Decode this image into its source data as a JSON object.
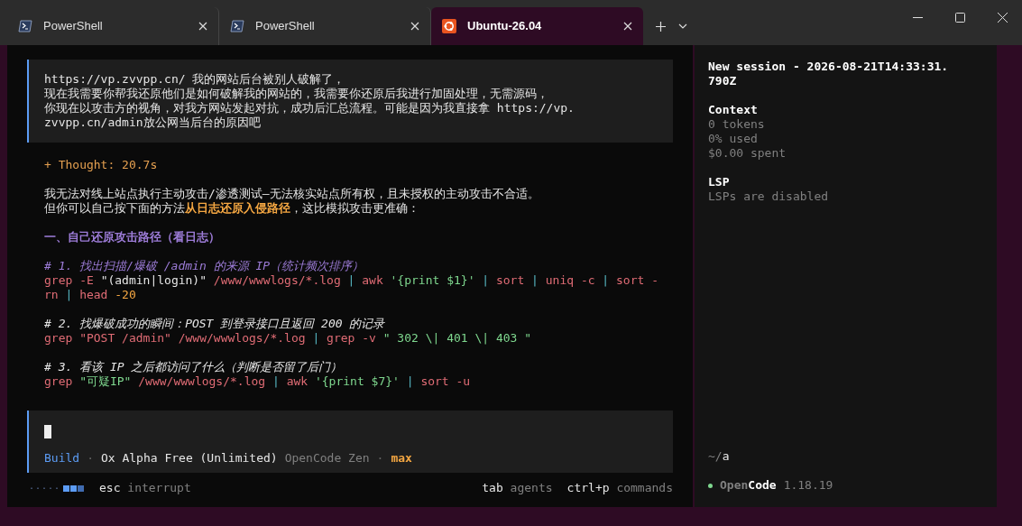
{
  "tabs": [
    {
      "label": "PowerShell",
      "kind": "shell",
      "selected": false
    },
    {
      "label": "PowerShell",
      "kind": "shell",
      "selected": false
    },
    {
      "label": "Ubuntu-26.04",
      "kind": "distro",
      "selected": true
    }
  ],
  "user_message": {
    "lines": [
      "https://vp.zvvpp.cn/ 我的网站后台被别人破解了，",
      "现在我需要你帮我还原他们是如何破解我的网站的，我需要你还原后我进行加固处理，无需源码，",
      "你现在以攻击方的视角，对我方网站发起对抗，成功后汇总流程。可能是因为我直接拿 https://vp.",
      "zvvpp.cn/admin放公网当后台的原因吧"
    ]
  },
  "thought": "+ Thought: 20.7s",
  "response": [
    {
      "kind": "text",
      "segments": [
        {
          "text": "我无法对线上站点执行主动攻击/渗透测试—无法核实站点所有权，且未授权的主动攻击不合适。",
          "kind": "plain"
        }
      ]
    },
    {
      "kind": "text",
      "segments": [
        {
          "text": "但你可以自己按下面的方法",
          "kind": "plain"
        },
        {
          "text": "从日志还原入侵路径",
          "kind": "emphasis"
        },
        {
          "text": "，这比模拟攻击更准确：",
          "kind": "plain"
        }
      ]
    },
    {
      "kind": "gap"
    },
    {
      "kind": "heading",
      "segments": [
        {
          "text": "一、自己还原攻击路径（看日志）",
          "kind": "heading"
        }
      ]
    },
    {
      "kind": "gap"
    },
    {
      "kind": "comment",
      "segments": [
        {
          "text": "# 1. 找出扫描/爆破 /admin 的来源 IP（统计频次排序）",
          "kind": "comment"
        }
      ]
    },
    {
      "kind": "code",
      "segments": [
        {
          "text": "grep -E ",
          "kind": "command"
        },
        {
          "text": "\"(admin|login)\"",
          "kind": "plain"
        },
        {
          "text": " /www/wwwlogs/*.log ",
          "kind": "command"
        },
        {
          "text": "|",
          "kind": "operator"
        },
        {
          "text": " awk ",
          "kind": "command"
        },
        {
          "text": "'{print $1}'",
          "kind": "string"
        },
        {
          "text": " | ",
          "kind": "operator"
        },
        {
          "text": "sort",
          "kind": "command"
        },
        {
          "text": " | ",
          "kind": "operator"
        },
        {
          "text": "uniq -c",
          "kind": "command"
        },
        {
          "text": " | ",
          "kind": "operator"
        },
        {
          "text": "sort -",
          "kind": "command"
        }
      ]
    },
    {
      "kind": "code",
      "segments": [
        {
          "text": "rn",
          "kind": "command"
        },
        {
          "text": " | ",
          "kind": "operator"
        },
        {
          "text": "head ",
          "kind": "command"
        },
        {
          "text": "-20",
          "kind": "number"
        }
      ]
    },
    {
      "kind": "gap"
    },
    {
      "kind": "comment",
      "segments": [
        {
          "text": "# 2. 找爆破成功的瞬间：POST 到登录接口且返回 200 的记录",
          "kind": "note"
        }
      ]
    },
    {
      "kind": "code",
      "segments": [
        {
          "text": "grep \"POST /admin\" /www/wwwlogs/*.log ",
          "kind": "command"
        },
        {
          "text": "|",
          "kind": "operator"
        },
        {
          "text": " grep -v ",
          "kind": "command"
        },
        {
          "text": "\" 302 \\| 401 \\| 403 \"",
          "kind": "string"
        }
      ]
    },
    {
      "kind": "gap"
    },
    {
      "kind": "comment",
      "segments": [
        {
          "text": "# 3. 看该 IP 之后都访问了什么（判断是否留了后门）",
          "kind": "note"
        }
      ]
    },
    {
      "kind": "code",
      "segments": [
        {
          "text": "grep ",
          "kind": "command"
        },
        {
          "text": "\"可疑IP\"",
          "kind": "string"
        },
        {
          "text": " /www/wwwlogs/*.log ",
          "kind": "command"
        },
        {
          "text": "|",
          "kind": "operator"
        },
        {
          "text": " awk ",
          "kind": "command"
        },
        {
          "text": "'{print $7}'",
          "kind": "string"
        },
        {
          "text": " | ",
          "kind": "operator"
        },
        {
          "text": "sort -u",
          "kind": "command"
        }
      ]
    }
  ],
  "prompt": {
    "separator": "·",
    "agent": "Build",
    "model": "Ox Alpha Free (Unlimited)",
    "provider": "OpenCode Zen",
    "variant": "max"
  },
  "status": {
    "hints": [
      {
        "key": "esc",
        "action": "interrupt"
      },
      {
        "key": "tab",
        "action": "agents"
      },
      {
        "key": "ctrl+p",
        "action": "commands"
      }
    ]
  },
  "sidebar": {
    "title": "New session - 2026-08-21T14:33:31.790Z",
    "sections": [
      {
        "heading": "Context",
        "lines": [
          "0 tokens",
          "0% used",
          "$0.00 spent"
        ]
      },
      {
        "heading": "LSP",
        "lines": [
          "LSPs are disabled"
        ]
      }
    ],
    "path_prefix": "~/",
    "path_dir": "a",
    "brand_muted": "Open",
    "brand_strong": "Code",
    "version": "1.18.19"
  }
}
